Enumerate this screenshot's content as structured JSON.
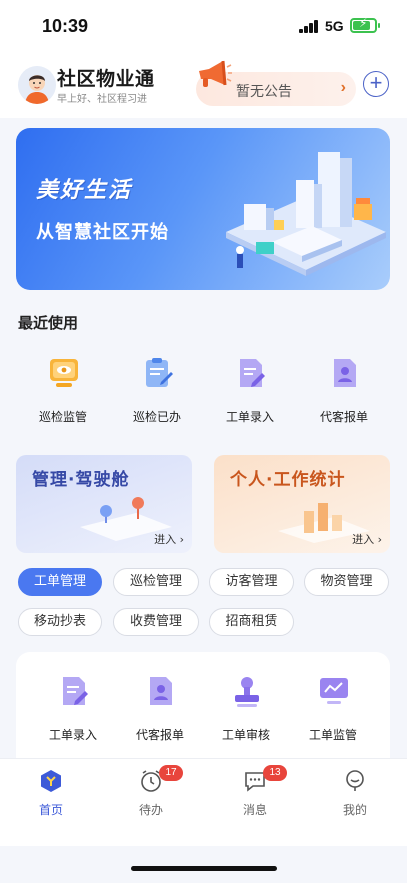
{
  "status_bar": {
    "time": "10:39",
    "network": "5G",
    "battery_level": 0.8
  },
  "header": {
    "title": "社区物业通",
    "greeting": "早上好、社区程习进",
    "notice": "暂无公告",
    "notice_arrow": "›",
    "add_label": "+"
  },
  "banner": {
    "title": "美好生活",
    "subtitle": "从智慧社区开始"
  },
  "recent": {
    "title": "最近使用",
    "items": [
      {
        "label": "巡检监管",
        "icon": "monitor-eye-icon"
      },
      {
        "label": "巡检已办",
        "icon": "clipboard-check-icon"
      },
      {
        "label": "工单录入",
        "icon": "document-edit-icon"
      },
      {
        "label": "代客报单",
        "icon": "document-person-icon"
      }
    ]
  },
  "cards": {
    "cockpit": {
      "title": "管理·驾驶舱",
      "enter": "进入 ›"
    },
    "stats": {
      "title": "个人·工作统计",
      "enter": "进入 ›"
    }
  },
  "categories": [
    {
      "label": "工单管理",
      "active": true
    },
    {
      "label": "巡检管理",
      "active": false
    },
    {
      "label": "访客管理",
      "active": false
    },
    {
      "label": "物资管理",
      "active": false
    },
    {
      "label": "移动抄表",
      "active": false
    },
    {
      "label": "收费管理",
      "active": false
    },
    {
      "label": "招商租赁",
      "active": false
    }
  ],
  "panel": {
    "items": [
      {
        "label": "工单录入",
        "icon": "document-edit-icon"
      },
      {
        "label": "代客报单",
        "icon": "document-person-icon"
      },
      {
        "label": "工单审核",
        "icon": "stamp-icon"
      },
      {
        "label": "工单监管",
        "icon": "monitor-chart-icon"
      }
    ]
  },
  "tabbar": {
    "items": [
      {
        "label": "首页",
        "icon": "home-hexagon-icon",
        "active": true
      },
      {
        "label": "待办",
        "icon": "clock-icon",
        "badge": "17"
      },
      {
        "label": "消息",
        "icon": "chat-bubble-icon",
        "badge": "13"
      },
      {
        "label": "我的",
        "icon": "person-icon"
      }
    ]
  },
  "colors": {
    "accent": "#4a78f0",
    "badge": "#e8453c",
    "brand_orange": "#e0702a"
  }
}
